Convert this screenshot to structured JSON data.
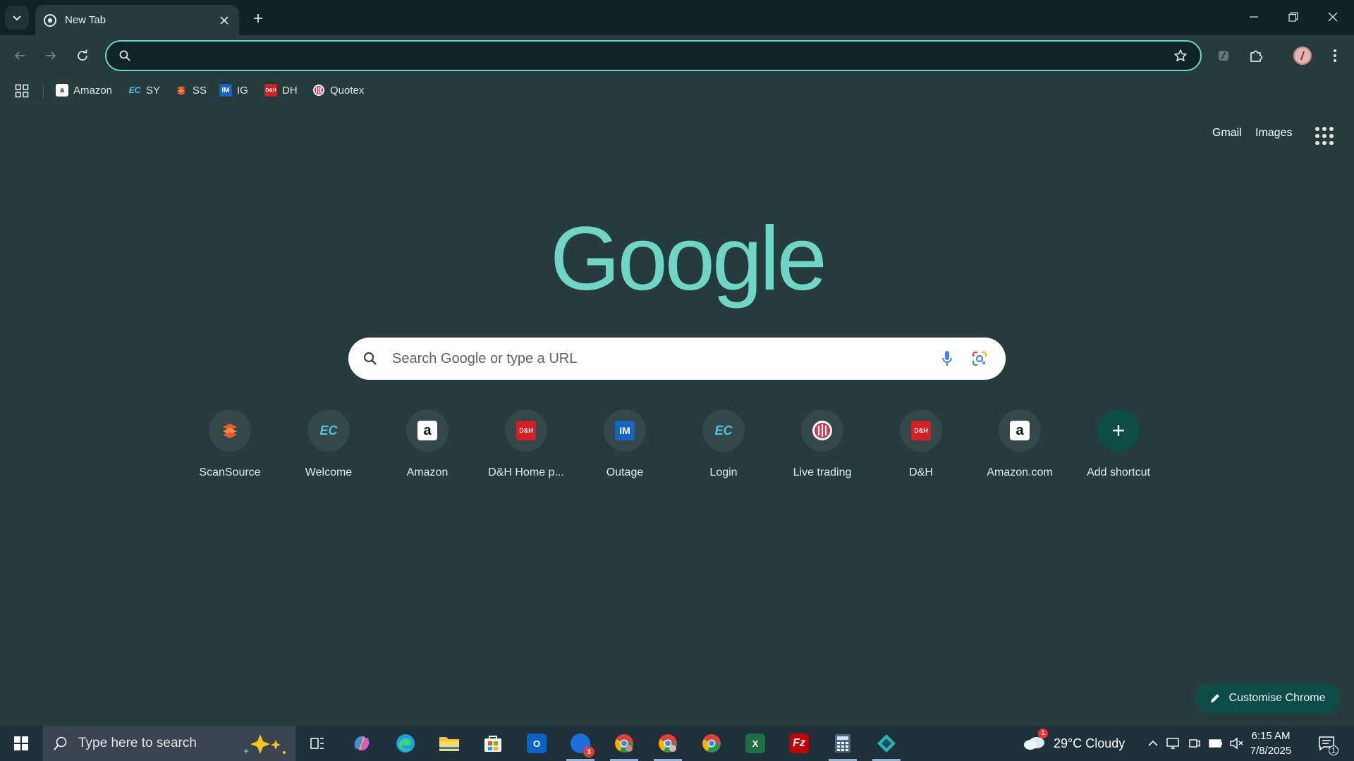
{
  "tab": {
    "title": "New Tab"
  },
  "omnibox": {
    "value": "",
    "placeholder": ""
  },
  "bookmarks": [
    {
      "label": "Amazon",
      "icon": "amazon-icon"
    },
    {
      "label": "SY",
      "icon": "ec-icon"
    },
    {
      "label": "SS",
      "icon": "scansource-icon"
    },
    {
      "label": "IG",
      "icon": "im-icon"
    },
    {
      "label": "DH",
      "icon": "dh-icon"
    },
    {
      "label": "Quotex",
      "icon": "quotex-icon"
    }
  ],
  "ntp": {
    "gmail": "Gmail",
    "images": "Images",
    "logo": "Google",
    "search_placeholder": "Search Google or type a URL",
    "customise": "Customise Chrome"
  },
  "shortcuts": [
    {
      "label": "ScanSource",
      "icon": "scansource-icon"
    },
    {
      "label": "Welcome",
      "icon": "ec-icon"
    },
    {
      "label": "Amazon",
      "icon": "amazon-icon"
    },
    {
      "label": "D&H Home p...",
      "icon": "dh-icon"
    },
    {
      "label": "Outage",
      "icon": "im-icon"
    },
    {
      "label": "Login",
      "icon": "ec-icon"
    },
    {
      "label": "Live trading",
      "icon": "quotex-icon"
    },
    {
      "label": "D&H",
      "icon": "dh-icon"
    },
    {
      "label": "Amazon.com",
      "icon": "amazon-icon"
    },
    {
      "label": "Add shortcut",
      "icon": "plus-icon"
    }
  ],
  "taskbar": {
    "search_placeholder": "Type here to search",
    "weather": "29°C  Cloudy",
    "weather_badge": "1",
    "time": "6:15 AM",
    "date": "7/8/2025",
    "notifications": "1",
    "mail_badge": "3"
  },
  "colors": {
    "background": "#263c3c",
    "tabstrip": "#0e2323",
    "accent": "#6fd6c6",
    "customise_bg": "#0e4d46",
    "taskbar": "#20303a"
  }
}
